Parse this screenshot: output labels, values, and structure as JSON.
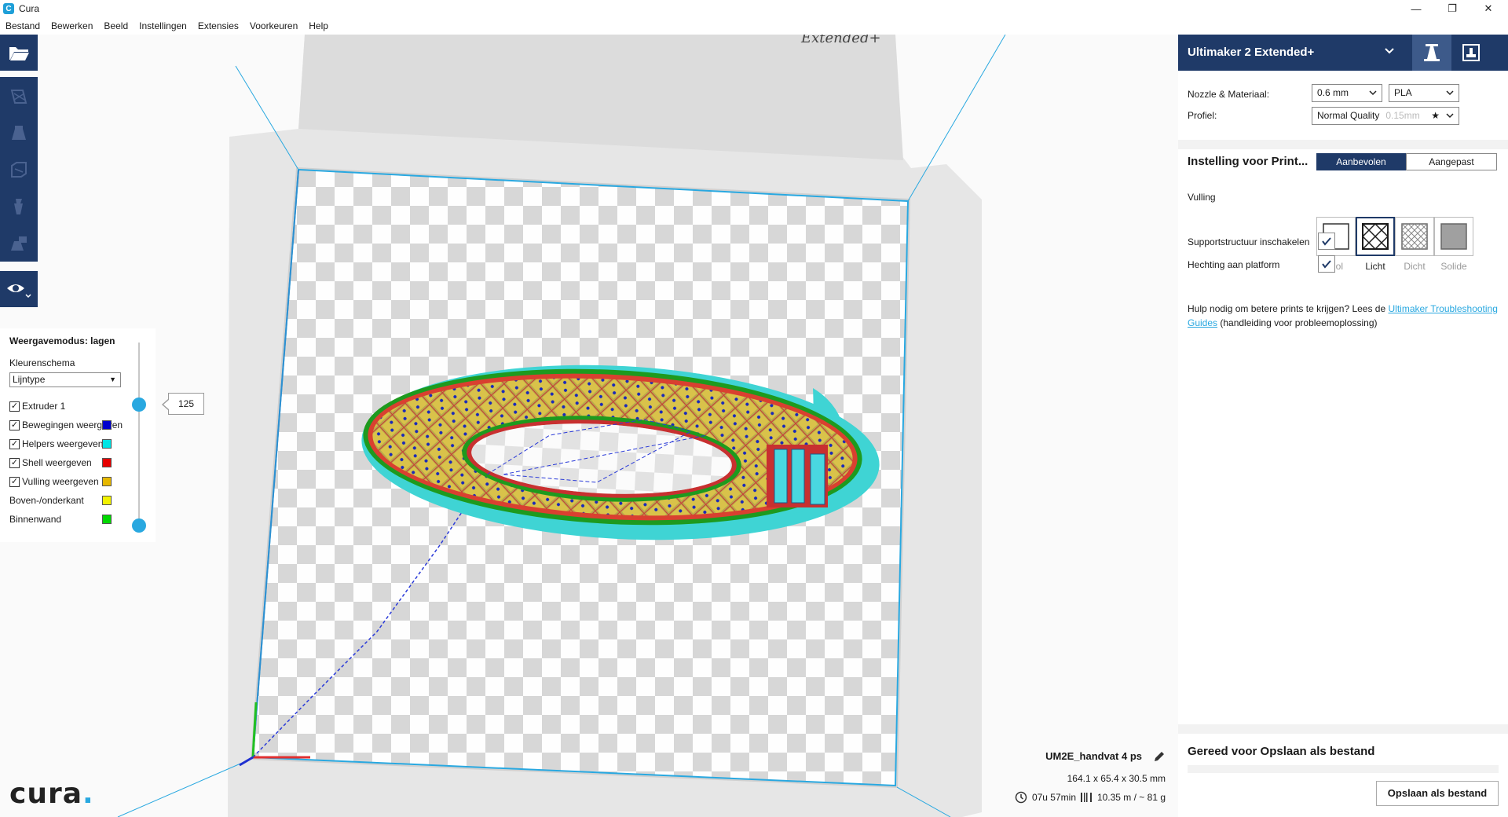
{
  "window": {
    "app_title": "Cura",
    "app_icon_letter": "C",
    "controls": {
      "minimize": "—",
      "restore": "❐",
      "close": "✕"
    }
  },
  "menu": [
    "Bestand",
    "Bewerken",
    "Beeld",
    "Instellingen",
    "Extensies",
    "Voorkeuren",
    "Help"
  ],
  "view_panel": {
    "title": "Weergavemodus: lagen",
    "color_scheme_label": "Kleurenschema",
    "color_scheme_value": "Lijntype",
    "layer_value": "125",
    "legend": [
      {
        "label": "Extruder 1",
        "checkbox": true,
        "checked": true,
        "color": ""
      },
      {
        "label": "Bewegingen weergeven",
        "checkbox": true,
        "checked": true,
        "color": "#0000cc"
      },
      {
        "label": "Helpers weergeven",
        "checkbox": true,
        "checked": true,
        "color": "#00e5e5"
      },
      {
        "label": "Shell weergeven",
        "checkbox": true,
        "checked": true,
        "color": "#e60000"
      },
      {
        "label": "Vulling weergeven",
        "checkbox": true,
        "checked": true,
        "color": "#e6b800"
      },
      {
        "label": "Boven-/onderkant",
        "checkbox": false,
        "checked": false,
        "color": "#f2f200"
      },
      {
        "label": "Binnenwand",
        "checkbox": false,
        "checked": false,
        "color": "#00d900"
      }
    ],
    "check_glyph": "✓"
  },
  "job": {
    "name": "UM2E_handvat 4 ps",
    "dimensions": "164.1 x 65.4 x 30.5 mm",
    "print_time": "07u 57min",
    "material_usage": "10.35 m / ~ 81 g"
  },
  "logo": {
    "text": "cura",
    "dot": "."
  },
  "build_plate_text": "Extended+",
  "sidebar": {
    "printer_name": "Ultimaker 2 Extended+",
    "nozzle_material_label": "Nozzle & Materiaal:",
    "nozzle_value": "0.6 mm",
    "material_value": "PLA",
    "profile_label": "Profiel:",
    "profile_value": "Normal Quality",
    "profile_hint": "0.15mm",
    "settings_title": "Instelling voor Print...",
    "tab_recommended": "Aanbevolen",
    "tab_custom": "Aangepast",
    "infill_label": "Vulling",
    "infill_options": [
      {
        "label": "Hol",
        "selected": false
      },
      {
        "label": "Licht",
        "selected": true
      },
      {
        "label": "Dicht",
        "selected": false
      },
      {
        "label": "Solide",
        "selected": false
      }
    ],
    "support_label": "Supportstructuur inschakelen",
    "adhesion_label": "Hechting aan platform",
    "help_text_before": "Hulp nodig om betere prints te krijgen? Lees de ",
    "help_link": "Ultimaker Troubleshooting Guides",
    "help_text_after": " (handleiding voor probleemoplossing)",
    "save_title": "Gereed voor Opslaan als bestand",
    "save_button": "Opslaan als bestand"
  },
  "colors": {
    "accent_dark": "#1f3a68",
    "accent_blue": "#29a8e0",
    "helper_cyan": "#00e5e5",
    "infill_yellow": "#e6b800",
    "shell_red": "#e60000",
    "inner_wall_green": "#00d900",
    "travel_blue": "#0000cc"
  }
}
